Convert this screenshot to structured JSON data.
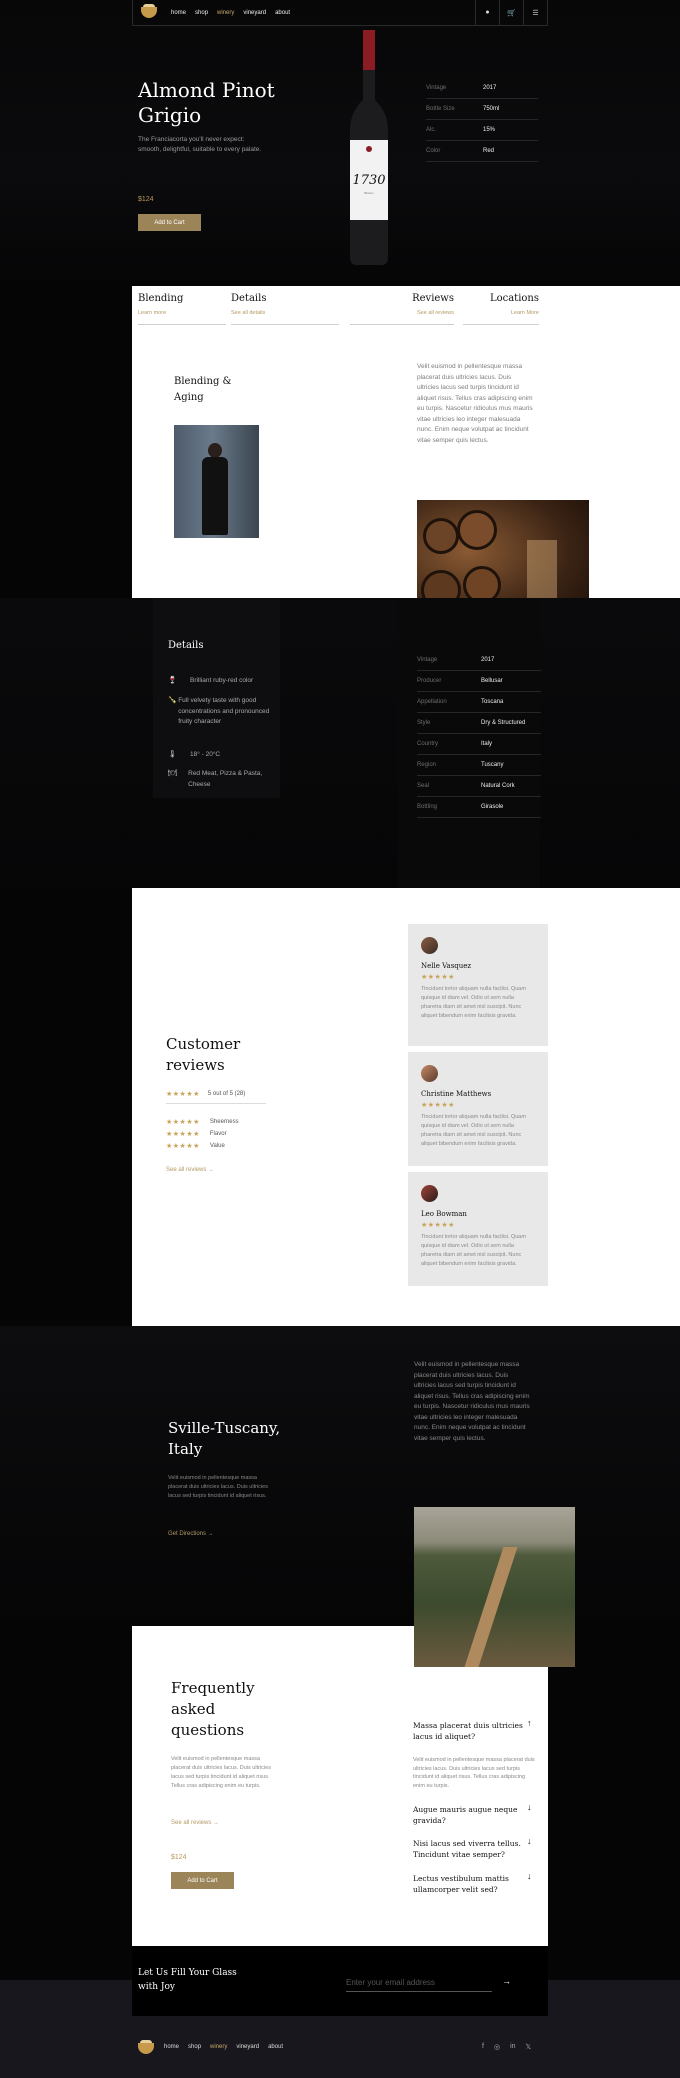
{
  "nav": {
    "links": [
      "home",
      "shop",
      "winery",
      "vineyard",
      "about"
    ],
    "active": "winery"
  },
  "hero": {
    "title": "Almond Pinot Grigio",
    "description": "The Franciacorta you'll never expect: smooth, delightful, suitable to every palate.",
    "price": "$124",
    "button": "Add to Cart",
    "bottle_label": "1730",
    "bottle_brand": "Blanco",
    "specs": [
      {
        "k": "Vintage",
        "v": "2017"
      },
      {
        "k": "Bottle Size",
        "v": "750ml"
      },
      {
        "k": "Alc.",
        "v": "15%"
      },
      {
        "k": "Color",
        "v": "Red"
      }
    ]
  },
  "tabs": [
    {
      "title": "Blending",
      "sub": "Learn more"
    },
    {
      "title": "Details",
      "sub": "See all details"
    },
    {
      "title": "Reviews",
      "sub": "See all reviews"
    },
    {
      "title": "Locations",
      "sub": "Learn More"
    }
  ],
  "blending": {
    "title": "Blending & Aging",
    "text": "Velit euismod in pellentesque massa placerat duis ultricies lacus. Duis ultricies lacus sed turpis tincidunt id aliquet risus. Tellus cras adipiscing enim eu turpis. Nascetur ridiculus mus mauris vitae ultricies leo integer malesuada nunc. Enim neque volutpat ac tincidunt vitae semper quis lectus."
  },
  "details": {
    "title": "Details",
    "items": [
      {
        "icon": "glass-icon",
        "glyph": "🍷",
        "text": "Brilliant ruby-red color"
      },
      {
        "icon": "bottle-icon",
        "glyph": "🍾",
        "text": "Full velvety taste with good concentrations and pronounced fruity character"
      },
      {
        "icon": "temperature-icon",
        "glyph": "🌡",
        "text": "18° - 20°C"
      },
      {
        "icon": "food-icon",
        "glyph": "🍽",
        "text": "Red Meat, Pizza & Pasta, Cheese"
      }
    ],
    "specs": [
      {
        "k": "Vintage",
        "v": "2017"
      },
      {
        "k": "Producer",
        "v": "Bellusar"
      },
      {
        "k": "Appellation",
        "v": "Toscana"
      },
      {
        "k": "Style",
        "v": "Dry & Structured"
      },
      {
        "k": "Country",
        "v": "Italy"
      },
      {
        "k": "Region",
        "v": "Tuscany"
      },
      {
        "k": "Seal",
        "v": "Natural Cork"
      },
      {
        "k": "Bottling",
        "v": "Girasole"
      }
    ]
  },
  "reviews": {
    "title": "Customer reviews",
    "stars": "★★★★★",
    "score": "5 out of 5 (28)",
    "subs": [
      "Sheerness",
      "Flavor",
      "Value"
    ],
    "link": "See all reviews →",
    "cards": [
      {
        "name": "Nelle Vasquez",
        "text": "Tincidunt tortor aliquam nulla facilisi. Quam quisque id diam vel. Odio ut sem nulla pharetra diam sit amet nisl suscipit. Nunc aliquet bibendum enim facilisis gravida."
      },
      {
        "name": "Christine Matthews",
        "text": "Tincidunt tortor aliquam nulla facilisi. Quam quisque id diam vel. Odio ut sem nulla pharetra diam sit amet nisl suscipit. Nunc aliquet bibendum enim facilisis gravida."
      },
      {
        "name": "Leo Bowman",
        "text": "Tincidunt tortor aliquam nulla facilisi. Quam quisque id diam vel. Odio ut sem nulla pharetra diam sit amet nisl suscipit. Nunc aliquet bibendum enim facilisis gravida."
      }
    ]
  },
  "location": {
    "title": "Sville-Tuscany, Italy",
    "desc": "Velit euismod in pellentesque massa placerat duis ultricies lacus. Duis ultricies lacus sed turpis tincidunt id aliquet risus.",
    "link": "Get Directions →",
    "text": "Velit euismod in pellentesque massa placerat duis ultricies lacus. Duis ultricies lacus sed turpis tincidunt id aliquet risus. Tellus cras adipiscing enim eu turpis. Nascetur ridiculus mus mauris vitae ultricies leo integer malesuada nunc. Enim neque volutpat ac tincidunt vitae semper quis lectus."
  },
  "faq": {
    "title": "Frequently asked questions",
    "desc": "Velit euismod in pellentesque massa placerat duis ultricies lacus. Duis ultricies lacus sed turpis tincidunt id aliquet risus. Tellus cras adipiscing enim eu turpis.",
    "link": "See all reviews →",
    "price": "$124",
    "button": "Add to Cart",
    "items": [
      {
        "q": "Massa placerat duis ultricies lacus id aliquet?",
        "a": "Velit euismod in pellentesque massa placerat duis ultricies lacus. Duis ultricies lacus sed turpis tincidunt id aliquet risus. Tellus cras adipiscing enim eu turpis."
      },
      {
        "q": "Augue mauris augue neque gravida?"
      },
      {
        "q": "Nisi lacus sed viverra tellus. Tincidunt vitae semper?"
      },
      {
        "q": "Lectus vestibulum mattis ullamcorper velit sed?"
      }
    ]
  },
  "newsletter": {
    "title": "Let Us Fill Your Glass with Joy",
    "placeholder": "Enter your email address"
  },
  "footer": {
    "links": [
      "home",
      "shop",
      "winery",
      "vineyard",
      "about"
    ],
    "active": "winery",
    "social": [
      "f",
      "◎",
      "in",
      "𝕏"
    ]
  }
}
